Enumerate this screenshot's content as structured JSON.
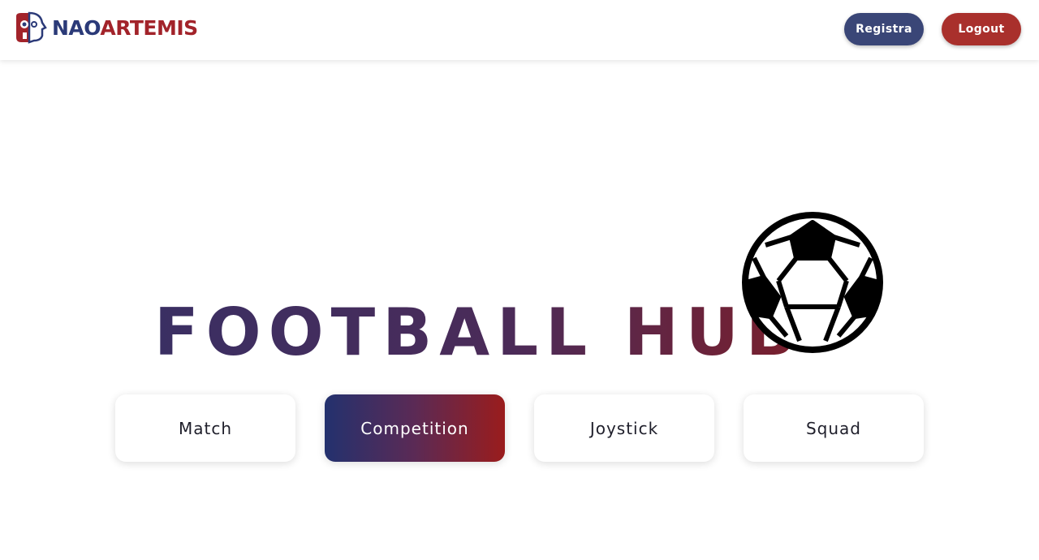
{
  "brand": {
    "name_part1": "NAO",
    "name_part2": "ARTEMIS",
    "color_primary": "#2b3a78",
    "color_secondary": "#a2232a"
  },
  "header": {
    "registra_label": "Registra",
    "logout_label": "Logout"
  },
  "hero": {
    "title": "FOOTBALL HUB",
    "icon": "soccer-ball-icon"
  },
  "nav_cards": [
    {
      "label": "Match",
      "active": false
    },
    {
      "label": "Competition",
      "active": true
    },
    {
      "label": "Joystick",
      "active": false
    },
    {
      "label": "Squad",
      "active": false
    }
  ],
  "colors": {
    "registra_bg": "#3a4677",
    "logout_bg": "#a9302c",
    "gradient_start": "#23316e",
    "gradient_end": "#9a1c1c"
  }
}
